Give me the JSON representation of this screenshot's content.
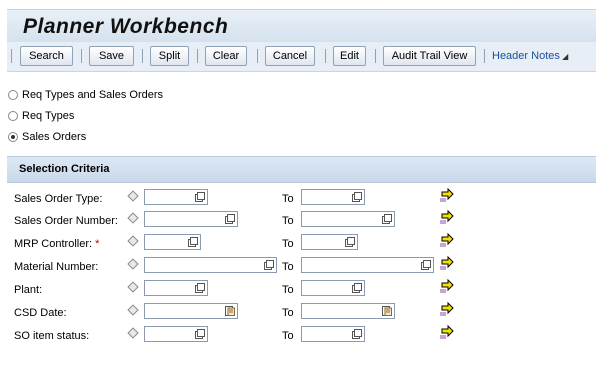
{
  "title": "Planner Workbench",
  "toolbar": {
    "search": "Search",
    "save": "Save",
    "split": "Split",
    "clear": "Clear",
    "cancel": "Cancel",
    "edit": "Edit",
    "audit": "Audit Trail View",
    "header_notes": "Header Notes"
  },
  "options": [
    {
      "label": "Req Types and Sales Orders",
      "selected": false
    },
    {
      "label": "Req Types",
      "selected": false
    },
    {
      "label": "Sales Orders",
      "selected": true
    }
  ],
  "section_title": "Selection Criteria",
  "to_label": "To",
  "fields": [
    {
      "label": "Sales Order Type:",
      "required": false,
      "help": "value-help-icon"
    },
    {
      "label": "Sales Order Number:",
      "required": false,
      "help": "value-help-icon"
    },
    {
      "label": "MRP Controller:",
      "required": true,
      "help": "value-help-icon"
    },
    {
      "label": "Material Number:",
      "required": false,
      "help": "value-help-icon"
    },
    {
      "label": "Plant:",
      "required": false,
      "help": "value-help-icon"
    },
    {
      "label": "CSD Date:",
      "required": false,
      "help": "calendar-icon"
    },
    {
      "label": "SO item status:",
      "required": false,
      "help": "value-help-icon"
    }
  ],
  "required_marker": "*"
}
